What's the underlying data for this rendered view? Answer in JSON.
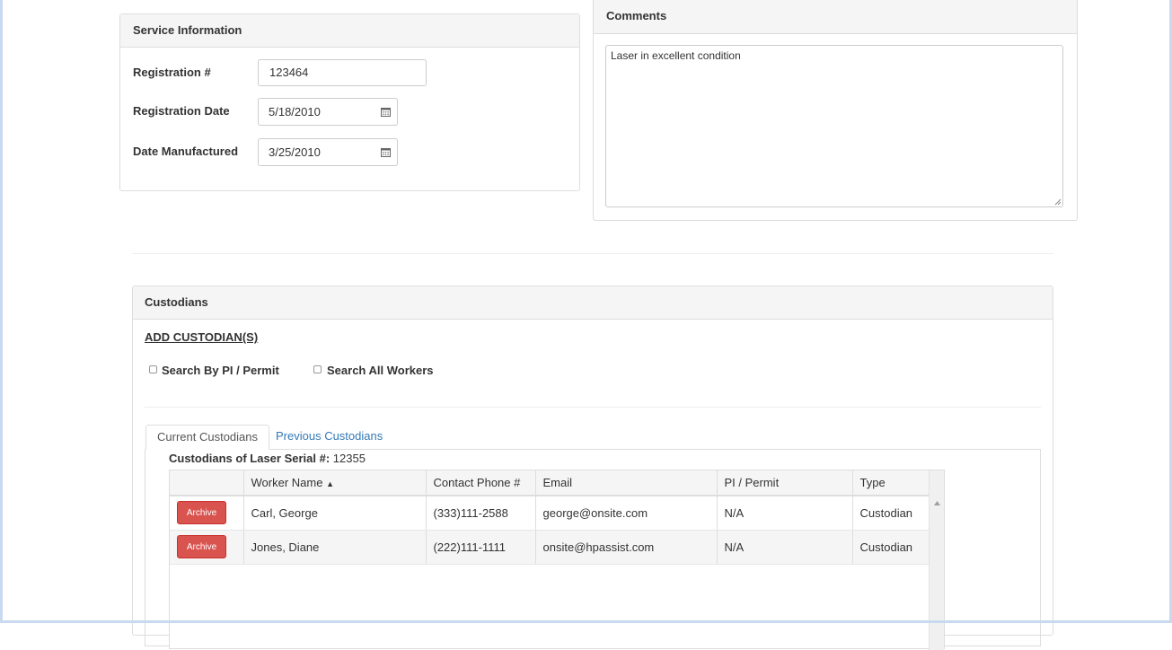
{
  "service": {
    "title": "Service Information",
    "registration_label": "Registration #",
    "registration_value": "123464",
    "reg_date_label": "Registration Date",
    "reg_date_value": "5/18/2010",
    "mfg_date_label": "Date Manufactured",
    "mfg_date_value": "3/25/2010"
  },
  "comments": {
    "title": "Comments",
    "text": "Laser in excellent condition"
  },
  "custodians": {
    "title": "Custodians",
    "add_link": "ADD CUSTODIAN(S)",
    "search_pi_label": "Search By PI / Permit",
    "search_all_label": "Search All Workers",
    "tabs": [
      {
        "label": "Current Custodians",
        "active": true
      },
      {
        "label": "Previous Custodians",
        "active": false
      }
    ],
    "serial_label": "Custodians of Laser Serial #:",
    "serial_value": "12355",
    "columns": [
      "",
      "Worker Name",
      "Contact Phone #",
      "Email",
      "PI / Permit",
      "Type"
    ],
    "sort_indicator": "▲",
    "archive_label": "Archive",
    "rows": [
      {
        "name": "Carl, George",
        "phone": "(333)111-2588",
        "email": "george@onsite.com",
        "permit": "N/A",
        "type": "Custodian"
      },
      {
        "name": "Jones, Diane",
        "phone": "(222)111-1111",
        "email": "onsite@hpassist.com",
        "permit": "N/A",
        "type": "Custodian"
      }
    ]
  },
  "colors": {
    "link": "#337ab7",
    "archive": "#d9534f",
    "frame": "#c9daf0"
  }
}
